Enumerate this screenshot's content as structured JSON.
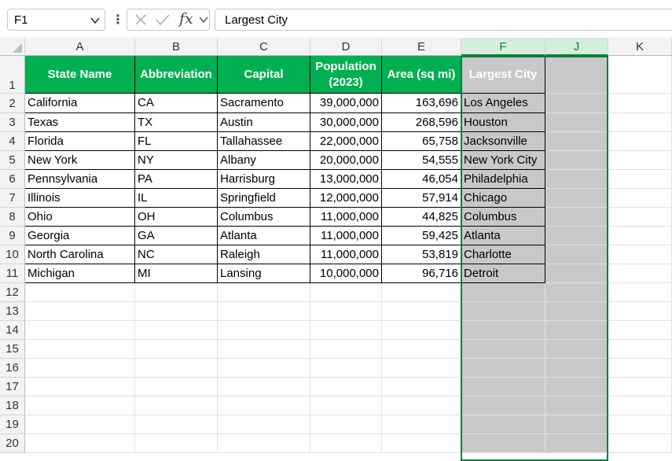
{
  "formula_bar": {
    "name_box": "F1",
    "formula": "Largest City",
    "fx_label": "fx",
    "icons": [
      "chevron-down-icon",
      "more-icon",
      "cancel-icon",
      "enter-icon",
      "insert-function-icon"
    ]
  },
  "columns": [
    "A",
    "B",
    "C",
    "D",
    "E",
    "F",
    "J",
    "K"
  ],
  "selected_columns": [
    "F",
    "J"
  ],
  "row_numbers": [
    "1",
    "2",
    "3",
    "4",
    "5",
    "6",
    "7",
    "8",
    "9",
    "10",
    "11",
    "12",
    "13",
    "14",
    "15",
    "16",
    "17",
    "18",
    "19",
    "20"
  ],
  "table": {
    "headers": [
      "State Name",
      "Abbreviation",
      "Capital",
      "Population (2023)",
      "Area (sq mi)",
      "Largest City"
    ],
    "rows": [
      [
        "California",
        "CA",
        "Sacramento",
        "39,000,000",
        "163,696",
        "Los Angeles"
      ],
      [
        "Texas",
        "TX",
        "Austin",
        "30,000,000",
        "268,596",
        "Houston"
      ],
      [
        "Florida",
        "FL",
        "Tallahassee",
        "22,000,000",
        "65,758",
        "Jacksonville"
      ],
      [
        "New York",
        "NY",
        "Albany",
        "20,000,000",
        "54,555",
        "New York City"
      ],
      [
        "Pennsylvania",
        "PA",
        "Harrisburg",
        "13,000,000",
        "46,054",
        "Philadelphia"
      ],
      [
        "Illinois",
        "IL",
        "Springfield",
        "12,000,000",
        "57,914",
        "Chicago"
      ],
      [
        "Ohio",
        "OH",
        "Columbus",
        "11,000,000",
        "44,825",
        "Columbus"
      ],
      [
        "Georgia",
        "GA",
        "Atlanta",
        "11,000,000",
        "59,425",
        "Atlanta"
      ],
      [
        "North Carolina",
        "NC",
        "Raleigh",
        "11,000,000",
        "53,819",
        "Charlotte"
      ],
      [
        "Michigan",
        "MI",
        "Lansing",
        "10,000,000",
        "96,716",
        "Detroit"
      ]
    ]
  },
  "colors": {
    "header_fill": "#00b050",
    "header_text": "#ffffff",
    "selection_border": "#107c41",
    "selection_fill": "#c8c8c8",
    "selected_header_fill": "#d3eedc"
  }
}
